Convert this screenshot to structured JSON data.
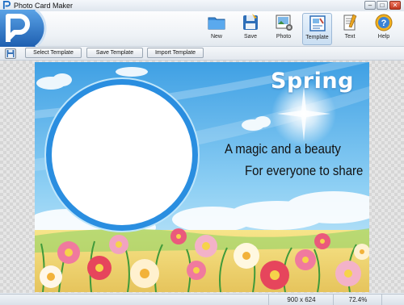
{
  "window": {
    "title": "Photo Card Maker",
    "minimize": "–",
    "maximize": "□",
    "close": "✕"
  },
  "toolbar": [
    {
      "label": "New",
      "icon": "folder-icon"
    },
    {
      "label": "Save",
      "icon": "save-icon"
    },
    {
      "label": "Photo",
      "icon": "photo-icon"
    },
    {
      "label": "Template",
      "icon": "template-icon"
    },
    {
      "label": "Text",
      "icon": "text-icon"
    },
    {
      "label": "Help",
      "icon": "help-icon"
    }
  ],
  "subtoolbar": {
    "select_template": "Select Template",
    "save_template": "Save Template",
    "import_template": "Import Template"
  },
  "card": {
    "title": "Spring",
    "line1": "A magic and a beauty",
    "line2": "For everyone to share"
  },
  "status": {
    "dimensions": "900 x 624",
    "zoom": "72.4%"
  },
  "colors": {
    "accent": "#2f7fd3",
    "sky": "#5fb8ec",
    "frame": "#2a8ee0"
  }
}
